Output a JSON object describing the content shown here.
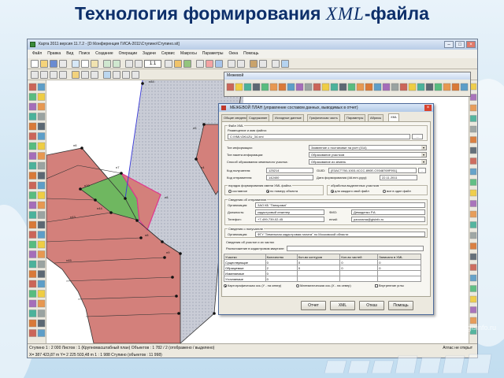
{
  "slide": {
    "title_main": "Технология формирования ",
    "title_xml": "XML",
    "title_tail": "-файла"
  },
  "window": {
    "title": "Карта 2011 версия 11.7.2 - [D:\\Конференция ГИСА-2011\\Ступино\\Ступино.sit]",
    "menu": [
      "Файл",
      "Правка",
      "Вид",
      "Поиск",
      "Создание",
      "Операции",
      "Задачи",
      "Сервис",
      "Макросы",
      "Параметры",
      "Окна",
      "Помощь"
    ],
    "scale_label": "1:1"
  },
  "map": {
    "fill_color": "#d3807b",
    "green_color": "#6fb760",
    "labels": [
      "n84",
      "n5",
      "n6",
      "n7",
      "n8",
      "n8",
      "n9",
      "n10",
      "n44",
      "n43",
      "n45",
      "n4"
    ]
  },
  "palette": {
    "title": "Межевой"
  },
  "dialog": {
    "title": "МЕЖЕВОЙ ПЛАН (управление составом данных, выводимых в отчет)",
    "tabs": [
      "Общие сведения",
      "Содержание",
      "Исходные данные",
      "Графическая часть",
      "Параметры",
      "Абрисы",
      "XML"
    ],
    "active_tab": "XML",
    "group_file": "Файл XML",
    "file_label": "Размещение и имя файла:",
    "file_path": "C:\\XML\\GKUZU_34.xml",
    "type_label": "Тип информации:",
    "type_value": "Заявление о постановке на учет (014)",
    "kind_label": "Тип пакета информации:",
    "kind_value": "Образование участков",
    "method_label": "Способ образования земельного участка:",
    "method_value": "Образование из земель",
    "recv_label": "Код получателя:",
    "recv_value": "125214",
    "send_label": "Код отправителя:",
    "send_value": "142400",
    "guid_label": "GUID:",
    "guid_value": "{E3ACT750-1003-4CCC-890E-C9348769F951}",
    "date_label": "Дата формирования (dd.mm.yyyy):",
    "date_value": "22.11.2011",
    "order_group": "порядок формирования имени XML файла",
    "order_opts": [
      "составное",
      "по номеру объекта"
    ],
    "proc_group": "обработка выделенных участков",
    "proc_opts": [
      "для каждого свой файл",
      "все в один файл"
    ],
    "sender_group": "Сведения об отправителе",
    "org_label": "Организация:",
    "org_value": "ЗАО КБ \"Панорама\"",
    "pos_label": "Должность:",
    "pos_value": "кадастровый инженер",
    "fio_label": "ФИО:",
    "fio_value": "Демиденко Р.А.",
    "tel_label": "Телефон:",
    "tel_value": "+7-499-739-02-45",
    "email_label": "email:",
    "email_value": "panorama@gisinfo.ru",
    "recipient_group": "Сведения о получателе",
    "rorg_label": "Организация:",
    "rorg_value": "ФГУ \"Земельная кадастровая палата\" по Московской области",
    "loc_group": "Сведения об участке и их частях",
    "loc_label": "Расположение в кадастровом квартале:",
    "table_headers": [
      "Участки",
      "Количество",
      "Кол-во контуров",
      "Кол-во частей",
      "Записано в XML"
    ],
    "table_rows": [
      [
        "Существующие",
        "0",
        "0",
        "0",
        "0"
      ],
      [
        "Образуемые",
        "2",
        "0",
        "0",
        "0"
      ],
      [
        "Изменяемые",
        "0",
        "",
        "",
        ""
      ],
      [
        "Уточняемые",
        "0",
        "",
        "",
        ""
      ]
    ],
    "checks": [
      "Картографическая ось (У - на север)",
      "Математическая ось (Х - на север)",
      "Внутренние углы"
    ],
    "buttons": [
      "Отчет",
      "XML",
      "Отказ",
      "Помощь"
    ]
  },
  "status": {
    "row1": "Ступино  1 : 2 000   Листов : 1   (Крупномасштабный план)  Объектов : 1 782 / 2  (отображено / выделено)",
    "row1_right": "Атлас не открыт",
    "row2": "X=   387 423,87 m    Y=  2 225 503,48 m        1 : 1 988     Ступино   (объектов : 11 998)"
  },
  "watermark": "gisinfo.ru"
}
